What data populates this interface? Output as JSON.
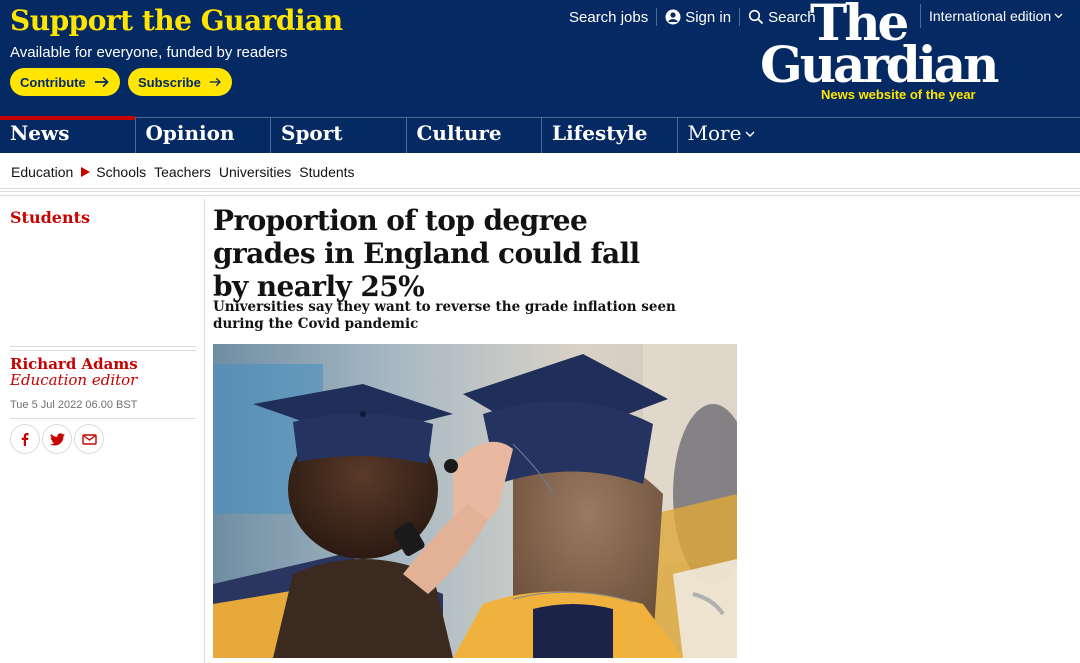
{
  "masthead": {
    "support_title": "Support the Guardian",
    "support_subtitle": "Available for everyone, funded by readers",
    "contribute_label": "Contribute",
    "subscribe_label": "Subscribe",
    "search_jobs": "Search jobs",
    "sign_in": "Sign in",
    "search": "Search",
    "edition": "International edition",
    "logo_the": "The",
    "logo_guardian": "Guardian",
    "logo_tagline": "News website of the year"
  },
  "nav": {
    "pillars": [
      {
        "label": "News",
        "active": true
      },
      {
        "label": "Opinion",
        "active": false
      },
      {
        "label": "Sport",
        "active": false
      },
      {
        "label": "Culture",
        "active": false
      },
      {
        "label": "Lifestyle",
        "active": false
      }
    ],
    "more": "More"
  },
  "subnav": {
    "items": [
      "Education",
      "Schools",
      "Teachers",
      "Universities",
      "Students"
    ]
  },
  "article": {
    "section": "Students",
    "headline": "Proportion of top degree grades in England could fall by nearly 25%",
    "standfirst": "Universities say they want to reverse the grade inflation seen during the Covid pandemic",
    "author": "Richard Adams",
    "role": "Education editor",
    "date": "Tue 5 Jul 2022 06.00 BST"
  },
  "icons": {
    "share": [
      "facebook-icon",
      "twitter-icon",
      "email-icon"
    ],
    "arrow": "arrow-right-icon",
    "user": "user-icon",
    "search": "search-icon",
    "chevron": "chevron-down-icon"
  },
  "colors": {
    "brand_blue": "#052962",
    "brand_yellow": "#ffe500",
    "news_red": "#c70000"
  }
}
